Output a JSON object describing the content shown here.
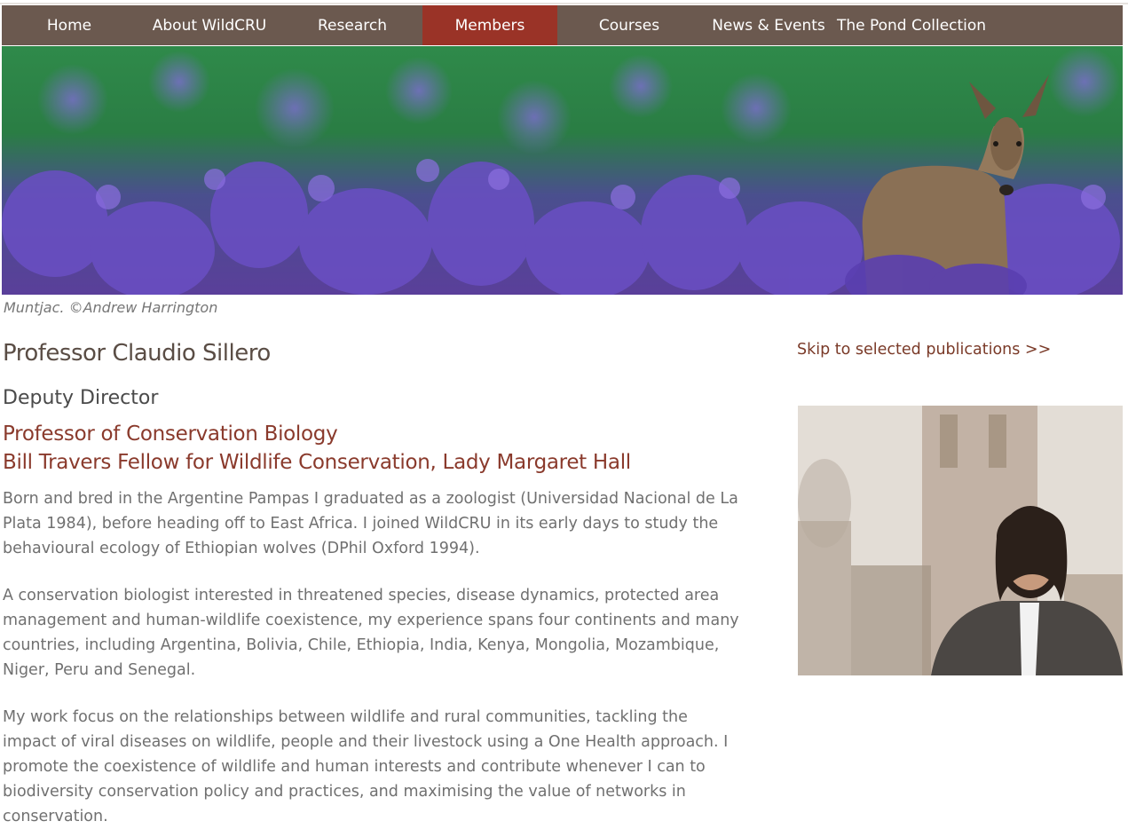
{
  "nav": {
    "items": [
      {
        "label": "Home"
      },
      {
        "label": "About WildCRU"
      },
      {
        "label": "Research"
      },
      {
        "label": "Members",
        "active": true
      },
      {
        "label": "Courses"
      },
      {
        "label": "News & Events"
      },
      {
        "label": "The Pond Collection"
      }
    ]
  },
  "banner": {
    "caption": "Muntjac. ©Andrew Harrington"
  },
  "profile": {
    "name": "Professor Claudio Sillero",
    "role": "Deputy Director",
    "title_1": "Professor of Conservation Biology",
    "title_2": "Bill Travers Fellow for Wildlife Conservation, Lady Margaret Hall",
    "paragraphs": [
      "Born and bred in the Argentine Pampas I graduated as a zoologist (Universidad Nacional de La Plata 1984), before heading off to East Africa. I joined WildCRU in its early days to study the behavioural ecology of Ethiopian wolves (DPhil Oxford 1994).",
      "A conservation biologist interested in threatened species, disease dynamics, protected area management and human-wildlife coexistence, my experience spans four continents and many countries, including Argentina, Bolivia, Chile, Ethiopia, India, Kenya, Mongolia, Mozambique, Niger, Peru and Senegal.",
      "My work focus on the relationships between wildlife and rural communities, tackling the impact of viral diseases on wildlife, people and their livestock using a One Health approach. I promote the coexistence of wildlife and human interests and contribute whenever I can to biodiversity conservation policy and practices, and maximising the value of networks in conservation."
    ]
  },
  "sidebar": {
    "skip_link": "Skip to selected publications >>"
  },
  "colors": {
    "nav_bg": "#6b594f",
    "nav_active": "#9a3327",
    "title_red": "#8a3a2c"
  }
}
